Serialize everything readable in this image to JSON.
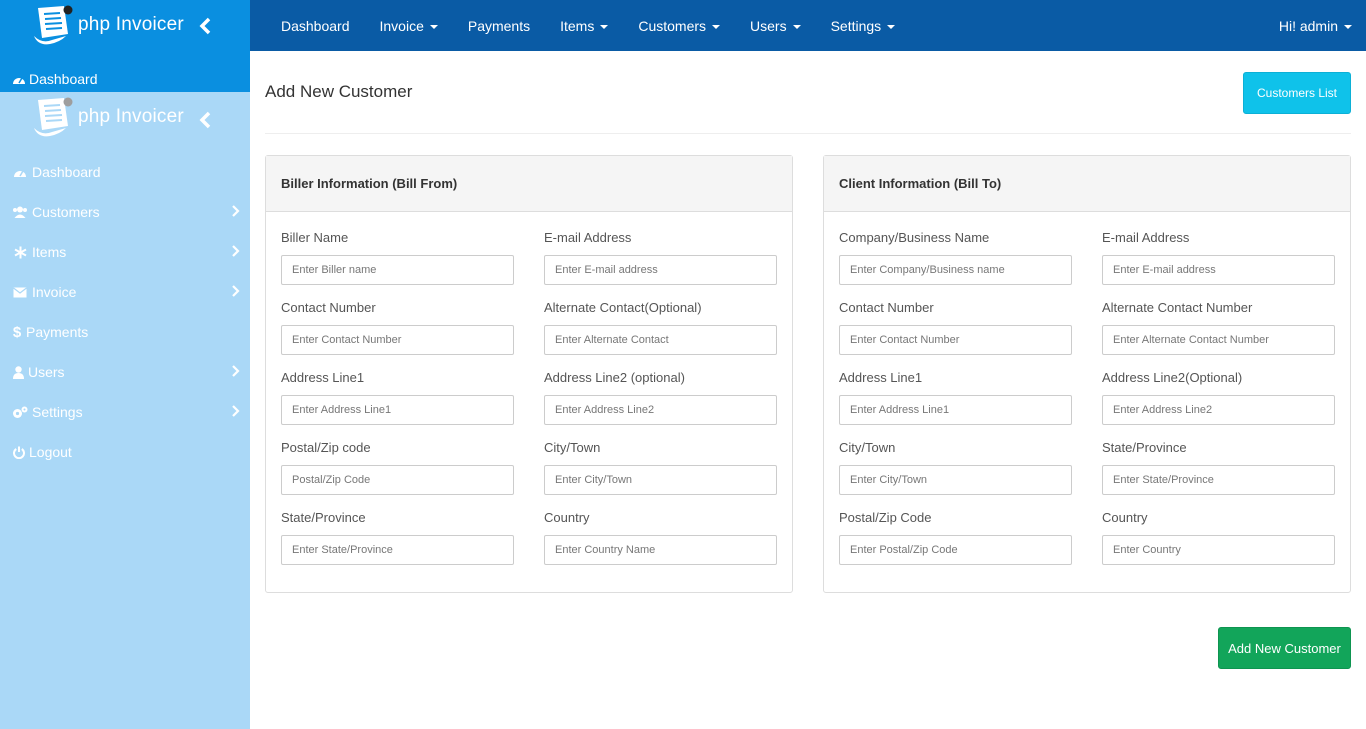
{
  "brand": {
    "name": "php Invoicer"
  },
  "sidebar": {
    "top_dashboard": "Dashboard",
    "items": [
      {
        "label": "Dashboard",
        "icon": "dashboard-icon",
        "has_submenu": false
      },
      {
        "label": "Customers",
        "icon": "users-icon",
        "has_submenu": true
      },
      {
        "label": "Items",
        "icon": "snowflake-icon",
        "has_submenu": true
      },
      {
        "label": "Invoice",
        "icon": "envelope-icon",
        "has_submenu": true
      },
      {
        "label": "Payments",
        "icon": "dollar-icon",
        "has_submenu": false
      },
      {
        "label": "Users",
        "icon": "user-icon",
        "has_submenu": true
      },
      {
        "label": "Settings",
        "icon": "gears-icon",
        "has_submenu": true
      },
      {
        "label": "Logout",
        "icon": "power-icon",
        "has_submenu": false
      }
    ]
  },
  "topnav": {
    "items": [
      {
        "label": "Dashboard",
        "dropdown": false
      },
      {
        "label": "Invoice",
        "dropdown": true
      },
      {
        "label": "Payments",
        "dropdown": false
      },
      {
        "label": "Items",
        "dropdown": true
      },
      {
        "label": "Customers",
        "dropdown": true
      },
      {
        "label": "Users",
        "dropdown": true
      },
      {
        "label": "Settings",
        "dropdown": true
      }
    ],
    "user": "Hi! admin"
  },
  "page": {
    "title": "Add New Customer",
    "list_button": "Customers List",
    "submit_button": "Add New Customer"
  },
  "biller": {
    "heading": "Biller Information (Bill From)",
    "fields": [
      {
        "label": "Biller Name",
        "placeholder": "Enter Biller name"
      },
      {
        "label": "E-mail Address",
        "placeholder": "Enter E-mail address"
      },
      {
        "label": "Contact Number",
        "placeholder": "Enter Contact Number"
      },
      {
        "label": "Alternate Contact(Optional)",
        "placeholder": "Enter Alternate Contact"
      },
      {
        "label": "Address Line1",
        "placeholder": "Enter Address Line1"
      },
      {
        "label": "Address Line2 (optional)",
        "placeholder": "Enter Address Line2"
      },
      {
        "label": "Postal/Zip code",
        "placeholder": "Postal/Zip Code"
      },
      {
        "label": "City/Town",
        "placeholder": "Enter City/Town"
      },
      {
        "label": "State/Province",
        "placeholder": "Enter State/Province"
      },
      {
        "label": "Country",
        "placeholder": "Enter Country Name"
      }
    ]
  },
  "client": {
    "heading": "Client Information (Bill To)",
    "fields": [
      {
        "label": "Company/Business Name",
        "placeholder": "Enter Company/Business name"
      },
      {
        "label": "E-mail Address",
        "placeholder": "Enter E-mail address"
      },
      {
        "label": "Contact Number",
        "placeholder": "Enter Contact Number"
      },
      {
        "label": "Alternate Contact Number",
        "placeholder": "Enter Alternate Contact Number"
      },
      {
        "label": "Address Line1",
        "placeholder": "Enter Address Line1"
      },
      {
        "label": "Address Line2(Optional)",
        "placeholder": "Enter Address Line2"
      },
      {
        "label": "City/Town",
        "placeholder": "Enter City/Town"
      },
      {
        "label": "State/Province",
        "placeholder": "Enter State/Province"
      },
      {
        "label": "Postal/Zip Code",
        "placeholder": "Enter Postal/Zip Code"
      },
      {
        "label": "Country",
        "placeholder": "Enter Country"
      }
    ]
  },
  "colors": {
    "topnav": "#0a5ba5",
    "sidebar": "#aad8f7",
    "sidebar_header": "#0a8fe0",
    "info_button": "#0fc2ea",
    "success_button": "#12a55a"
  }
}
